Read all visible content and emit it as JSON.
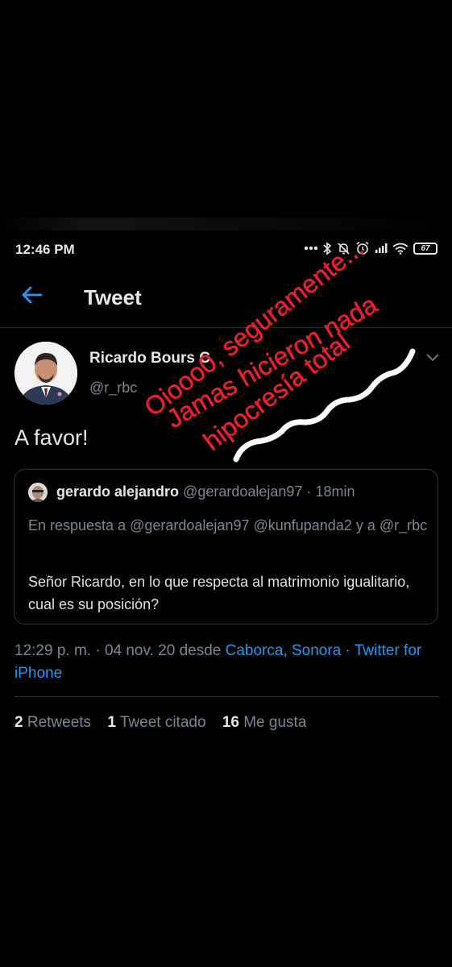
{
  "status_bar": {
    "time": "12:46 PM",
    "battery": "67",
    "icons": [
      "dots-icon",
      "bluetooth-icon",
      "bell-off-icon",
      "alarm-icon",
      "signal-icon",
      "wifi-icon",
      "battery-icon"
    ]
  },
  "header": {
    "title": "Tweet"
  },
  "tweet": {
    "author_name": "Ricardo Bours C",
    "author_handle": "@r_rbc",
    "text": "A favor!",
    "quoted": {
      "name": "gerardo alejandro",
      "meta": "@gerardoalejan97 · 18min",
      "reply_prefix": "En respuesta a",
      "reply_to": "@gerardoalejan97 @kunfupanda2 y a @r_rbc",
      "body": "Señor Ricardo, en lo que respecta al matrimonio igualitario, cual es su posición?"
    },
    "time": "12:29 p. m.",
    "date": "04 nov. 20",
    "from": "desde",
    "location": "Caborca, Sonora",
    "client": "Twitter for iPhone",
    "retweets_count": "2",
    "retweets_label": "Retweets",
    "quotes_count": "1",
    "quotes_label": "Tweet citado",
    "likes_count": "16",
    "likes_label": "Me gusta"
  },
  "overlay": {
    "line1": "Oiooo0, seguramente...",
    "line2": "Jamas hicieron nada",
    "line3": "hipocresía total",
    "color": "#e8202a"
  },
  "colors": {
    "background": "#000000",
    "accent": "#1d9bf0",
    "secondary_text": "#7a8793"
  }
}
